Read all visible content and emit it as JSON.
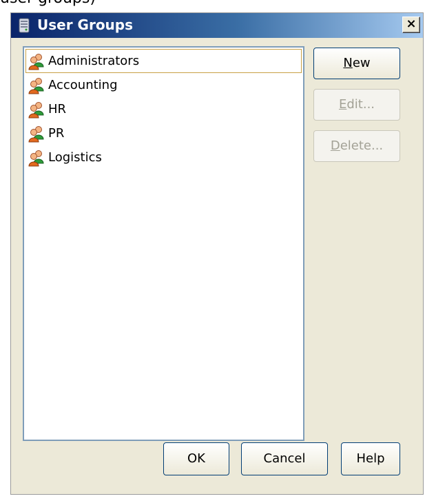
{
  "caption": "user groups)",
  "window": {
    "title": "User Groups",
    "close_label": "×"
  },
  "groups": [
    {
      "label": "Administrators",
      "selected": true
    },
    {
      "label": "Accounting"
    },
    {
      "label": "HR"
    },
    {
      "label": "PR"
    },
    {
      "label": "Logistics"
    }
  ],
  "buttons": {
    "new": {
      "mnemonic": "N",
      "rest": "ew"
    },
    "edit": {
      "mnemonic": "E",
      "rest": "dit..."
    },
    "delete": {
      "mnemonic": "D",
      "rest": "elete..."
    },
    "ok": "OK",
    "cancel": "Cancel",
    "help": "Help"
  }
}
